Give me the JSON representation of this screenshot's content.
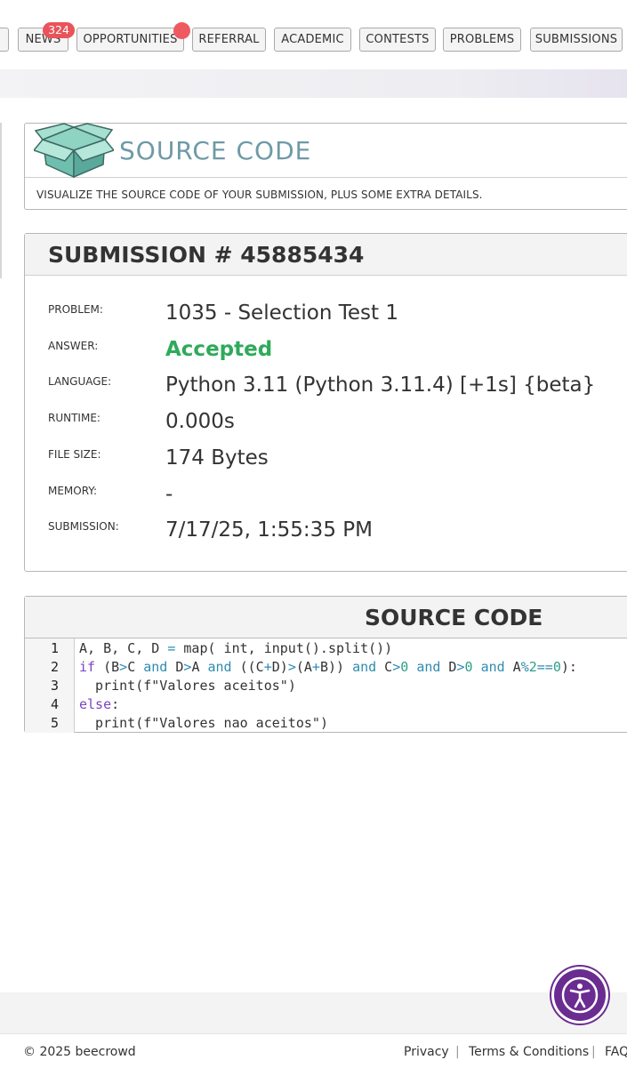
{
  "nav": {
    "items": [
      "NEWS",
      "OPPORTUNITIES",
      "REFERRAL",
      "ACADEMIC",
      "CONTESTS",
      "PROBLEMS",
      "SUBMISSIONS"
    ],
    "news_badge": "324"
  },
  "header": {
    "title": "SOURCE CODE",
    "description": "VISUALIZE THE SOURCE CODE OF YOUR SUBMISSION, PLUS SOME EXTRA DETAILS."
  },
  "submission": {
    "title": "SUBMISSION # 45885434",
    "fields": [
      {
        "label": "PROBLEM:",
        "value": "1035 - Selection Test 1"
      },
      {
        "label": "ANSWER:",
        "value": "Accepted"
      },
      {
        "label": "LANGUAGE:",
        "value": "Python 3.11 (Python 3.11.4) [+1s] {beta}"
      },
      {
        "label": "RUNTIME:",
        "value": "0.000s"
      },
      {
        "label": "FILE SIZE:",
        "value": "174 Bytes"
      },
      {
        "label": "MEMORY:",
        "value": "-"
      },
      {
        "label": "SUBMISSION:",
        "value": "7/17/25, 1:55:35 PM"
      }
    ],
    "answer_color": "#2eaa5b"
  },
  "code": {
    "title": "SOURCE CODE",
    "line_numbers": [
      "1",
      "2",
      "3",
      "4",
      "5"
    ],
    "lines": [
      "A, B, C, D = map( int, input().split())",
      "if (B>C and D>A and ((C+D)>(A+B)) and C>0 and D>0 and A%2==0):",
      "  print(f\"Valores aceitos\")",
      "else:",
      "  print(f\"Valores nao aceitos\")"
    ]
  },
  "footer": {
    "copyright": "© 2025 beecrowd",
    "links": [
      "Privacy",
      "Terms & Conditions",
      "FAQ"
    ]
  },
  "icons": {
    "logo": "open-box-icon",
    "accessibility": "accessibility-icon"
  },
  "colors": {
    "title_accent": "#6e9aa6",
    "badge": "#e8545a",
    "accessibility": "#6a2c91"
  }
}
